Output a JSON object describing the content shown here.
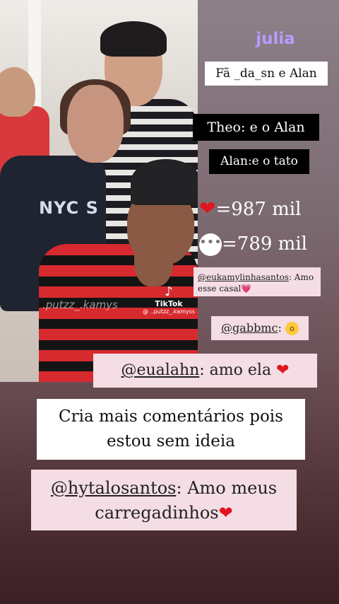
{
  "story_title": "julia",
  "tags": {
    "line1": "Fã _da_sn e Alan",
    "line2": "Theo: e o Alan",
    "line3": "Alan:e o tato"
  },
  "stats": {
    "likes_icon": "heart-icon",
    "likes": "=987 mil",
    "comments_icon": "speech-bubble-icon",
    "comments": "=789 mil"
  },
  "photo": {
    "shirt_text": "NYC S",
    "watermark": ".putzz_.kamys",
    "tiktok_brand": "TikTok",
    "tiktok_user": "@ ..putzz_.kamyss"
  },
  "comments": [
    {
      "user": "@eukamylinhasantos",
      "text": ": Amo esse casal",
      "emoji": "💗"
    },
    {
      "user": "@gabbmc",
      "text": ": ",
      "emoji": "😲"
    },
    {
      "user": "@eualahn",
      "text": ": amo ela ",
      "emoji": "❤"
    },
    {
      "user": "",
      "text": "Cria mais comentários pois estou sem ideia",
      "emoji": ""
    },
    {
      "user": "@hytalosantos",
      "text": ": Amo meus carregadinhos",
      "emoji": "❤"
    }
  ],
  "colors": {
    "title": "#b79cff",
    "heart": "#e0151f",
    "comment_bg": "#f4dde4"
  }
}
